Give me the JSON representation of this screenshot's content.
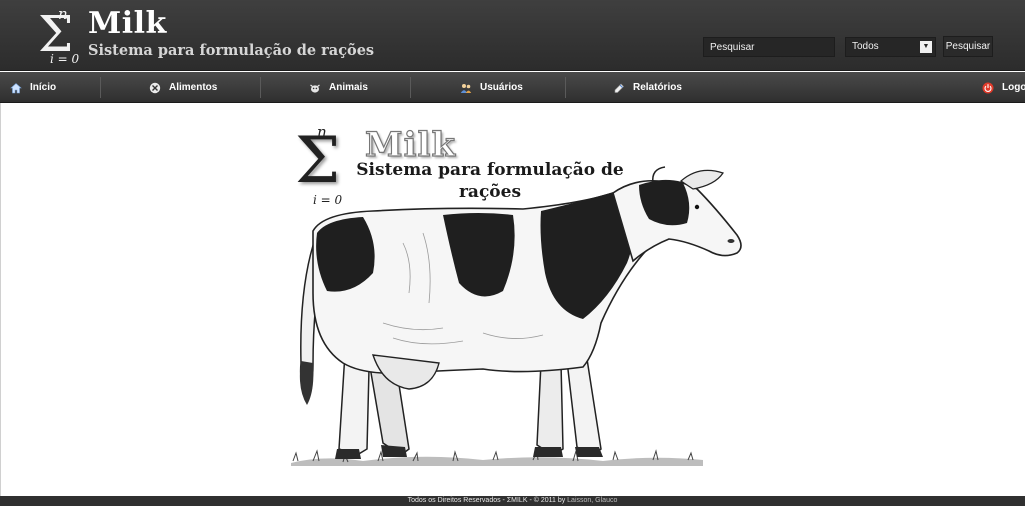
{
  "header": {
    "logo": {
      "sigma_upper": "n",
      "sigma_symbol": "Σ",
      "sigma_lower": "i = 0",
      "brand": "Milk",
      "tagline": "Sistema para formulação de rações"
    },
    "search": {
      "placeholder": "Pesquisar",
      "filter_selected": "Todos",
      "button_label": "Pesquisar"
    }
  },
  "nav": {
    "items": [
      {
        "label": "Início",
        "icon": "home-icon"
      },
      {
        "label": "Alimentos",
        "icon": "food-icon"
      },
      {
        "label": "Animais",
        "icon": "cow-icon"
      },
      {
        "label": "Usuários",
        "icon": "users-icon"
      },
      {
        "label": "Relatórios",
        "icon": "report-icon"
      },
      {
        "label": "Logout",
        "icon": "power-icon"
      }
    ]
  },
  "main": {
    "hero": {
      "sigma_upper": "n",
      "sigma_symbol": "Σ",
      "sigma_lower": "i = 0",
      "brand": "Milk",
      "tagline": "Sistema para formulação de rações"
    }
  },
  "footer": {
    "text": "Todos os Direitos Reservados - ΣMILK - © 2011 by ",
    "authors": "Laisson, Glauco"
  },
  "colors": {
    "header_bg": "#353535",
    "nav_bg": "#3d3d3d",
    "logout_icon": "#e03a2a"
  }
}
